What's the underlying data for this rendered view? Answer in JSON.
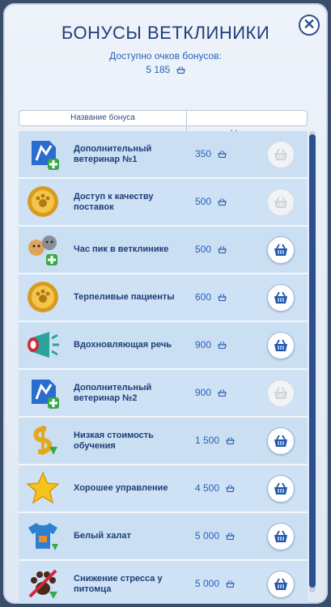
{
  "window": {
    "title": "БОНУСЫ ВЕТКЛИНИКИ",
    "available_label": "Доступно очков бонусов:",
    "available_points": "5 185"
  },
  "columns": {
    "name": "Название бонуса",
    "price": "Цена"
  },
  "colors": {
    "accent": "#2a62b5",
    "title": "#1f3f7a",
    "row": "#cfe1f5",
    "scrollbar": "#2c4f8f"
  },
  "perks": [
    {
      "name": "Дополнительный ветеринар №1",
      "price": "350",
      "icon": "extra-vet-icon",
      "can_buy": false
    },
    {
      "name": "Доступ к качеству поставок",
      "price": "500",
      "icon": "gold-medal-icon",
      "can_buy": false
    },
    {
      "name": "Час пик в ветклинике",
      "price": "500",
      "icon": "dog-cat-icon",
      "can_buy": true
    },
    {
      "name": "Терпеливые пациенты",
      "price": "600",
      "icon": "gold-medal-icon",
      "can_buy": true
    },
    {
      "name": "Вдохновляющая речь",
      "price": "900",
      "icon": "megaphone-icon",
      "can_buy": true
    },
    {
      "name": "Дополнительный ветеринар №2",
      "price": "900",
      "icon": "extra-vet-icon",
      "can_buy": false
    },
    {
      "name": "Низкая стоимость обучения",
      "price": "1 500",
      "icon": "money-down-icon",
      "can_buy": true
    },
    {
      "name": "Хорошее управление",
      "price": "4 500",
      "icon": "star-icon",
      "can_buy": true
    },
    {
      "name": "Белый халат",
      "price": "5 000",
      "icon": "shirt-icon",
      "can_buy": true
    },
    {
      "name": "Снижение стресса у питомца",
      "price": "5 000",
      "icon": "paw-icon",
      "can_buy": true
    }
  ]
}
